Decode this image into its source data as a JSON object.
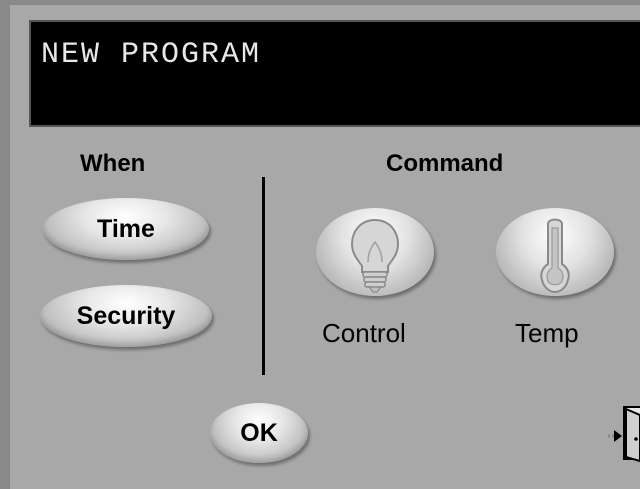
{
  "header": {
    "title": "NEW PROGRAM"
  },
  "when": {
    "label": "When",
    "buttons": [
      {
        "label": "Time"
      },
      {
        "label": "Security"
      }
    ]
  },
  "command": {
    "label": "Command",
    "buttons": [
      {
        "label": "Control",
        "icon": "light-bulb-icon"
      },
      {
        "label": "Temp",
        "icon": "thermometer-icon"
      }
    ]
  },
  "footer": {
    "ok_label": "OK",
    "exit_icon": "exit-door-icon"
  }
}
